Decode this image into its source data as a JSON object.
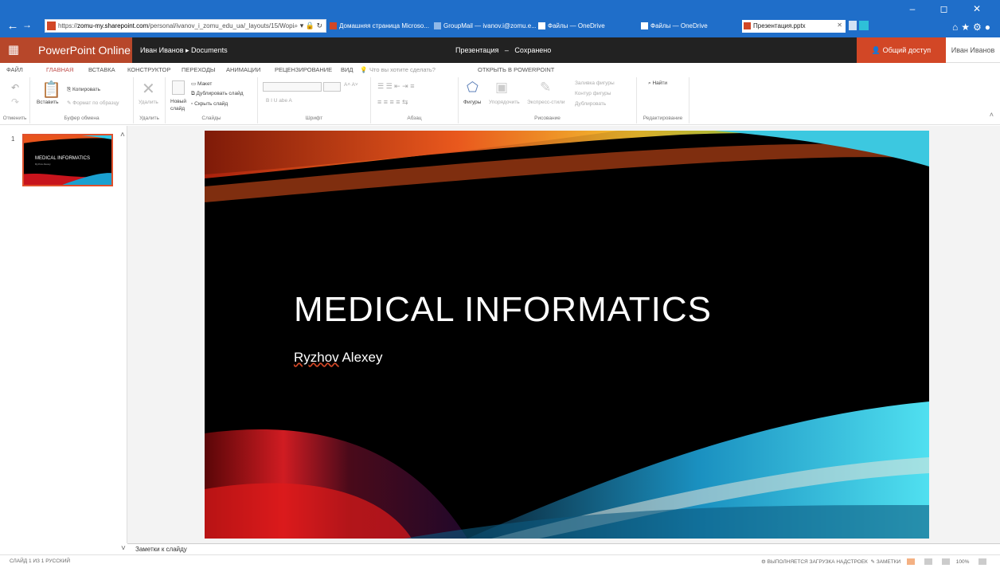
{
  "browser": {
    "url": "https://",
    "url_host": "zomu-my.sharepoint.com",
    "url_path": "/personal/ivanov_i_zomu_edu_ua/_layouts/15/Wopi",
    "tabs": [
      {
        "label": "Домашняя страница Microso..."
      },
      {
        "label": "GroupMail — ivanov.i@zomu.e..."
      },
      {
        "label": "Файлы — OneDrive"
      },
      {
        "label": "Файлы — OneDrive"
      },
      {
        "label": "Презентация.pptx"
      }
    ],
    "window_controls": "– ◻ ✕"
  },
  "app": {
    "name": "PowerPoint Online",
    "breadcrumb": "Иван Иванов ▸ Documents",
    "doc_name": "Презентация",
    "doc_sep": "–",
    "doc_status": "Сохранено",
    "share_label": "Общий доступ",
    "user_name": "Иван Иванов"
  },
  "ribbon_tabs": [
    "ФАЙЛ",
    "ГЛАВНАЯ",
    "ВСТАВКА",
    "КОНСТРУКТОР",
    "ПЕРЕХОДЫ",
    "АНИМАЦИИ",
    "РЕЦЕНЗИРОВАНИЕ",
    "ВИД",
    "Что вы хотите сделать?",
    "ОТКРЫТЬ В POWERPOINT"
  ],
  "ribbon": {
    "undo_label": "Отменить",
    "paste": "Вставить",
    "copy": "Копировать",
    "format_painter": "Формат по образцу",
    "clipboard_group": "Буфер обмена",
    "delete": "Удалить",
    "delete_group": "Удалить",
    "new_slide": "Новый слайд",
    "layout": "Макет",
    "duplicate": "Дублировать слайд",
    "hide": "Скрыть слайд",
    "slides_group": "Слайды",
    "font_group": "Шрифт",
    "paragraph_group": "Абзац",
    "shapes": "Фигуры",
    "arrange": "Упорядочить",
    "quick_styles": "Экспресс-стили",
    "shape_fill": "Заливка фигуры",
    "shape_outline": "Контур фигуры",
    "shape_dup": "Дублировать",
    "drawing_group": "Рисование",
    "find": "Найти",
    "editing_group": "Редактирование"
  },
  "slide_pane": {
    "slide_number": "1",
    "thumb_title": "MEDICAL INFORMATICS",
    "thumb_sub": "Ryzhov Alexey"
  },
  "slide": {
    "title": "MEDICAL INFORMATICS",
    "subtitle_first": "Ryzhov",
    "subtitle_rest": " Alexey"
  },
  "notes_label": "Заметки к слайду",
  "status": {
    "left": "СЛАЙД 1 ИЗ 1   РУССКИЙ",
    "addins": "ВЫПОЛНЯЕТСЯ ЗАГРУЗКА НАДСТРОЕК",
    "notes": "ЗАМЕТКИ",
    "zoom": "100%"
  },
  "colors": {
    "accent": "#b7472a",
    "share": "#d24726",
    "browser": "#1f6ec9"
  }
}
